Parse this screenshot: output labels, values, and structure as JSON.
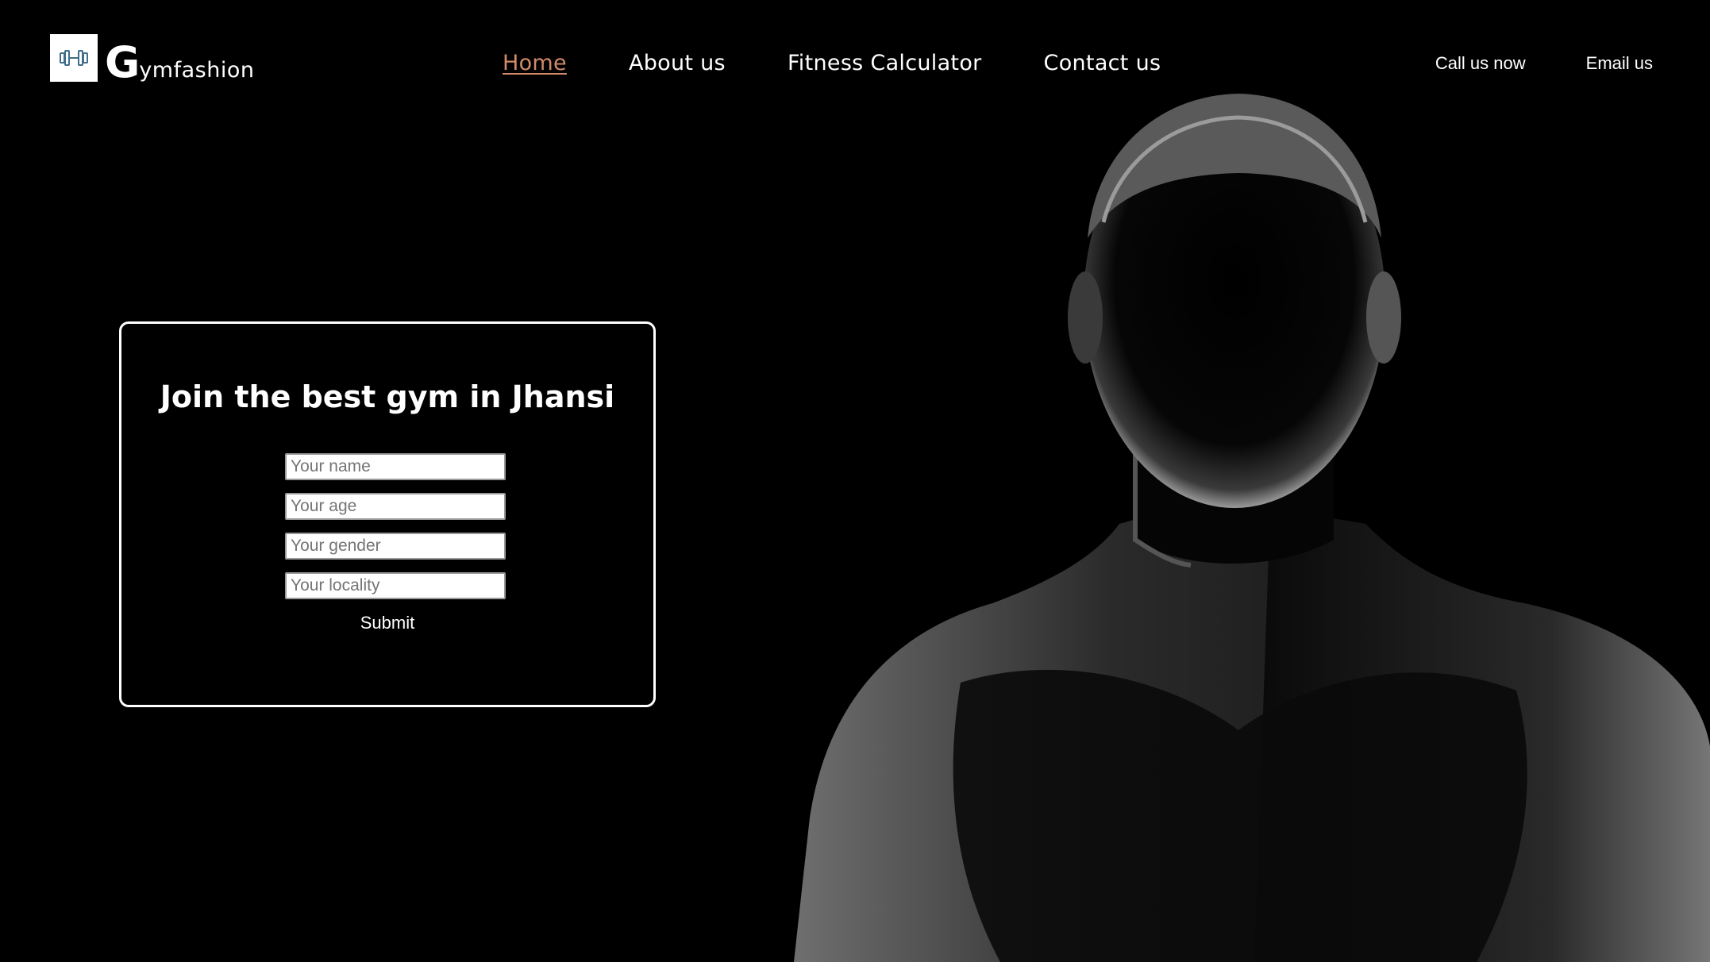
{
  "brand": {
    "initial": "G",
    "rest": "ymfashion",
    "logo_icon": "dumbbell-icon"
  },
  "nav": {
    "items": [
      {
        "label": "Home",
        "active": true
      },
      {
        "label": "About us",
        "active": false
      },
      {
        "label": "Fitness Calculator",
        "active": false
      },
      {
        "label": "Contact us",
        "active": false
      }
    ]
  },
  "header_actions": {
    "call_label": "Call us now",
    "email_label": "Email us"
  },
  "join_form": {
    "title": "Join the best gym in Jhansi",
    "name_placeholder": "Your name",
    "age_placeholder": "Your age",
    "gender_placeholder": "Your gender",
    "locality_placeholder": "Your locality",
    "submit_label": "Submit"
  },
  "colors": {
    "background": "#000000",
    "text": "#ffffff",
    "nav_active": "#d18a6a",
    "logo_icon": "#3f6d8a"
  }
}
